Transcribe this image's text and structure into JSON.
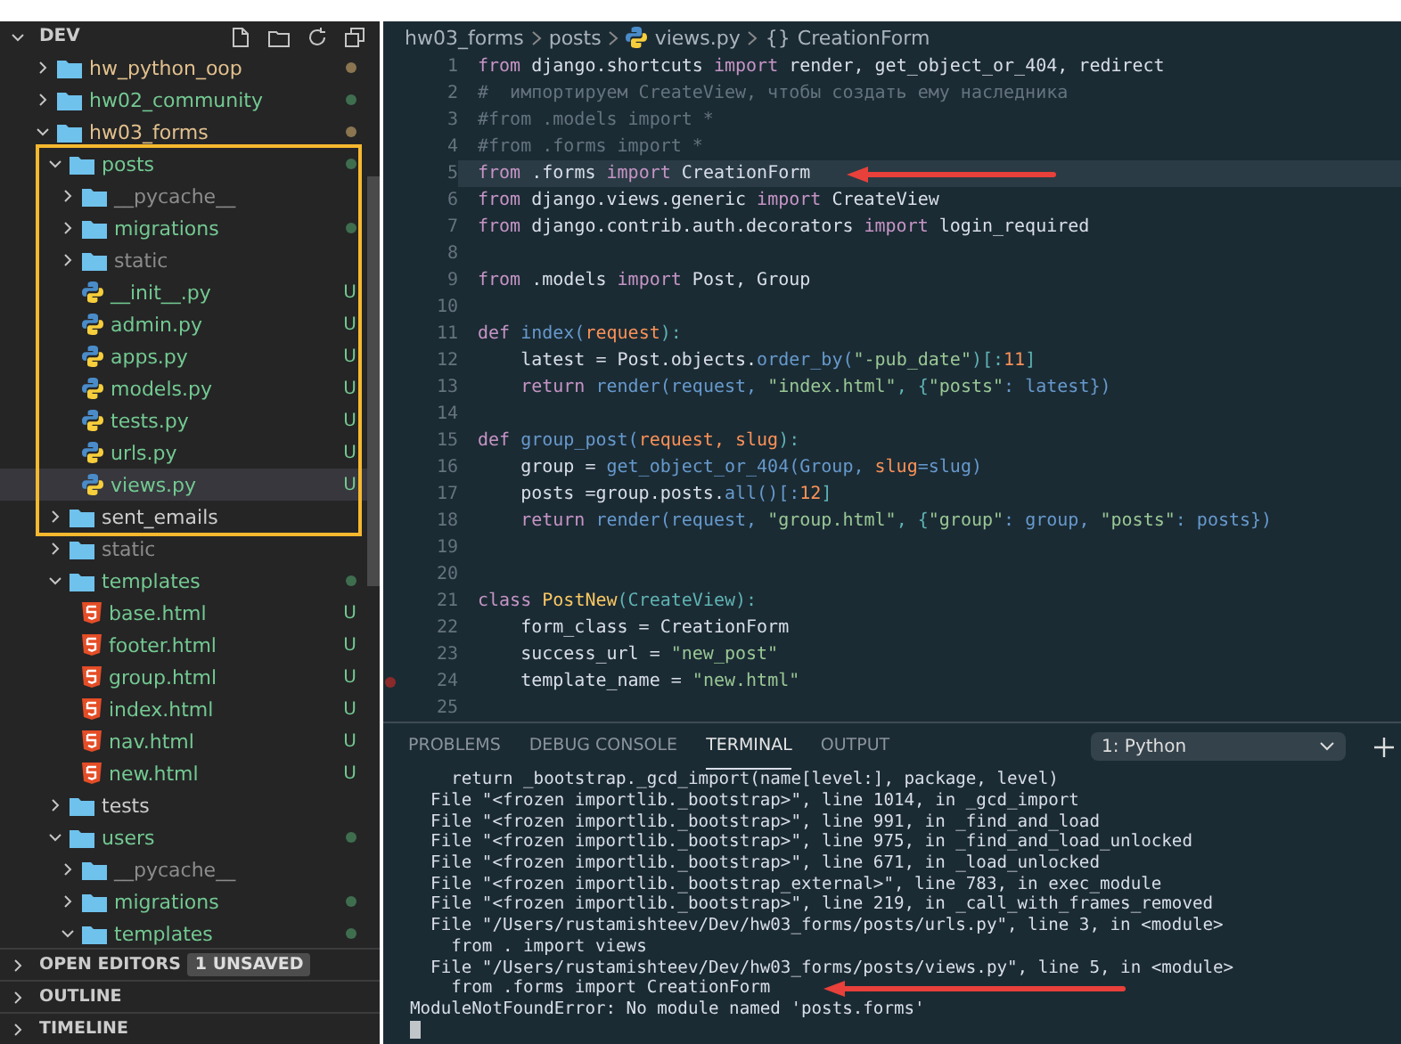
{
  "explorer": {
    "title": "DEV",
    "tree": [
      {
        "name": "hw_python_oop",
        "kind": "folder",
        "expanded": false,
        "color": "#e2c08d",
        "dot": {
          "color": "#8a7550"
        },
        "selected": false
      },
      {
        "name": "hw02_community",
        "kind": "folder",
        "expanded": false,
        "color": "#73c991",
        "dot": {
          "color": "#3f6e4f"
        },
        "selected": false
      },
      {
        "name": "hw03_forms",
        "kind": "folder",
        "expanded": true,
        "color": "#e2c08d",
        "dot": {
          "color": "#8a7550"
        },
        "selected": false,
        "children": [
          {
            "name": "posts",
            "kind": "folder",
            "expanded": true,
            "color": "#73c991",
            "dot": {
              "color": "#3f6e4f"
            },
            "selected": false,
            "children": [
              {
                "name": "__pycache__",
                "kind": "folder",
                "expanded": false,
                "color": "#8c8c8c",
                "selected": false
              },
              {
                "name": "migrations",
                "kind": "folder",
                "expanded": false,
                "color": "#73c991",
                "dot": {
                  "color": "#3f6e4f"
                },
                "selected": false
              },
              {
                "name": "static",
                "kind": "folder",
                "expanded": false,
                "color": "#8c8c8c",
                "selected": false
              },
              {
                "name": "__init__.py",
                "kind": "python",
                "color": "#73c991",
                "badge": "U",
                "selected": false
              },
              {
                "name": "admin.py",
                "kind": "python",
                "color": "#73c991",
                "badge": "U",
                "selected": false
              },
              {
                "name": "apps.py",
                "kind": "python",
                "color": "#73c991",
                "badge": "U",
                "selected": false
              },
              {
                "name": "models.py",
                "kind": "python",
                "color": "#73c991",
                "badge": "U",
                "selected": false
              },
              {
                "name": "tests.py",
                "kind": "python",
                "color": "#73c991",
                "badge": "U",
                "selected": false
              },
              {
                "name": "urls.py",
                "kind": "python",
                "color": "#73c991",
                "badge": "U",
                "selected": false
              },
              {
                "name": "views.py",
                "kind": "python",
                "color": "#73c991",
                "badge": "U",
                "selected": true
              }
            ]
          },
          {
            "name": "sent_emails",
            "kind": "folder",
            "expanded": false,
            "color": "#cccccc",
            "selected": false
          },
          {
            "name": "static",
            "kind": "folder",
            "expanded": false,
            "color": "#8c8c8c",
            "selected": false
          },
          {
            "name": "templates",
            "kind": "folder",
            "expanded": true,
            "color": "#73c991",
            "dot": {
              "color": "#3f6e4f"
            },
            "selected": false,
            "children": [
              {
                "name": "base.html",
                "kind": "html",
                "color": "#73c991",
                "badge": "U",
                "selected": false
              },
              {
                "name": "footer.html",
                "kind": "html",
                "color": "#73c991",
                "badge": "U",
                "selected": false
              },
              {
                "name": "group.html",
                "kind": "html",
                "color": "#73c991",
                "badge": "U",
                "selected": false
              },
              {
                "name": "index.html",
                "kind": "html",
                "color": "#73c991",
                "badge": "U",
                "selected": false
              },
              {
                "name": "nav.html",
                "kind": "html",
                "color": "#73c991",
                "badge": "U",
                "selected": false
              },
              {
                "name": "new.html",
                "kind": "html",
                "color": "#73c991",
                "badge": "U",
                "selected": false
              }
            ]
          },
          {
            "name": "tests",
            "kind": "folder",
            "expanded": false,
            "color": "#cccccc",
            "selected": false
          },
          {
            "name": "users",
            "kind": "folder",
            "expanded": true,
            "color": "#73c991",
            "dot": {
              "color": "#3f6e4f"
            },
            "selected": false,
            "children": [
              {
                "name": "__pycache__",
                "kind": "folder",
                "expanded": false,
                "color": "#8c8c8c",
                "selected": false
              },
              {
                "name": "migrations",
                "kind": "folder",
                "expanded": false,
                "color": "#73c991",
                "dot": {
                  "color": "#3f6e4f"
                },
                "selected": false
              },
              {
                "name": "templates",
                "kind": "folder",
                "expanded": true,
                "color": "#73c991",
                "dot": {
                  "color": "#3f6e4f"
                },
                "selected": false
              }
            ]
          }
        ]
      }
    ],
    "sections": [
      {
        "label": "OPEN EDITORS",
        "badge": "1 UNSAVED"
      },
      {
        "label": "OUTLINE"
      },
      {
        "label": "TIMELINE"
      }
    ]
  },
  "breadcrumb": [
    {
      "kind": "folder",
      "text": "hw03_forms"
    },
    {
      "kind": "folder",
      "text": "posts"
    },
    {
      "kind": "python",
      "text": "views.py"
    },
    {
      "kind": "symbol",
      "icon": "{}",
      "text": "CreationForm"
    }
  ],
  "editor": {
    "lines": [
      {
        "number": "1",
        "tokens": [
          {
            "kind": "kw",
            "text": "from"
          },
          {
            "kind": "id",
            "text": " django.shortcuts "
          },
          {
            "kind": "kw",
            "text": "import"
          },
          {
            "kind": "id",
            "text": " render, get_object_or_404, redirect"
          }
        ],
        "current": false,
        "breakpoint": false,
        "arrow": false
      },
      {
        "number": "2",
        "tokens": [
          {
            "kind": "cm",
            "text": "#  импортируем CreateView, чтобы создать ему наследника"
          }
        ],
        "current": false,
        "breakpoint": false,
        "arrow": false
      },
      {
        "number": "3",
        "tokens": [
          {
            "kind": "cm",
            "text": "#from .models import *"
          }
        ],
        "current": false,
        "breakpoint": false,
        "arrow": false
      },
      {
        "number": "4",
        "tokens": [
          {
            "kind": "cm",
            "text": "#from .forms import *"
          }
        ],
        "current": false,
        "breakpoint": false,
        "arrow": false
      },
      {
        "number": "5",
        "tokens": [
          {
            "kind": "kw",
            "text": "from"
          },
          {
            "kind": "id",
            "text": " .forms "
          },
          {
            "kind": "kw",
            "text": "import"
          },
          {
            "kind": "id",
            "text": " CreationForm"
          }
        ],
        "current": true,
        "breakpoint": false,
        "arrow": true
      },
      {
        "number": "6",
        "tokens": [
          {
            "kind": "kw",
            "text": "from"
          },
          {
            "kind": "id",
            "text": " django.views.generic "
          },
          {
            "kind": "kw",
            "text": "import"
          },
          {
            "kind": "id",
            "text": " CreateView"
          }
        ],
        "current": false,
        "breakpoint": false,
        "arrow": false
      },
      {
        "number": "7",
        "tokens": [
          {
            "kind": "kw",
            "text": "from"
          },
          {
            "kind": "id",
            "text": " django.contrib.auth.decorators "
          },
          {
            "kind": "kw",
            "text": "import"
          },
          {
            "kind": "id",
            "text": " login_required"
          }
        ],
        "current": false,
        "breakpoint": false,
        "arrow": false
      },
      {
        "number": "8",
        "current": false,
        "breakpoint": false,
        "arrow": false
      },
      {
        "number": "9",
        "tokens": [
          {
            "kind": "kw",
            "text": "from"
          },
          {
            "kind": "id",
            "text": " .models "
          },
          {
            "kind": "kw",
            "text": "import"
          },
          {
            "kind": "id",
            "text": " Post, Group"
          }
        ],
        "current": false,
        "breakpoint": false,
        "arrow": false
      },
      {
        "number": "10",
        "current": false,
        "breakpoint": false,
        "arrow": false
      },
      {
        "number": "11",
        "tokens": [
          {
            "kind": "kw",
            "text": "def"
          },
          {
            "kind": "fn",
            "text": " index("
          },
          {
            "kind": "param",
            "text": "request"
          },
          {
            "kind": "op",
            "text": "):"
          }
        ],
        "current": false,
        "breakpoint": false,
        "arrow": false
      },
      {
        "number": "12",
        "tokens": [
          {
            "kind": "id",
            "text": "    latest = Post.objects."
          },
          {
            "kind": "fn",
            "text": "order_by("
          },
          {
            "kind": "str",
            "text": "\"-pub_date\""
          },
          {
            "kind": "op",
            "text": ")[:"
          },
          {
            "kind": "num",
            "text": "11"
          },
          {
            "kind": "op",
            "text": "]"
          }
        ],
        "current": false,
        "breakpoint": false,
        "arrow": false
      },
      {
        "number": "13",
        "tokens": [
          {
            "kind": "kw",
            "text": "    return"
          },
          {
            "kind": "fn",
            "text": " render(request, "
          },
          {
            "kind": "str",
            "text": "\"index.html\""
          },
          {
            "kind": "op",
            "text": ", {"
          },
          {
            "kind": "str",
            "text": "\"posts\""
          },
          {
            "kind": "fn",
            "text": ": latest})"
          }
        ],
        "current": false,
        "breakpoint": false,
        "arrow": false
      },
      {
        "number": "14",
        "current": false,
        "breakpoint": false,
        "arrow": false
      },
      {
        "number": "15",
        "tokens": [
          {
            "kind": "kw",
            "text": "def"
          },
          {
            "kind": "fn",
            "text": " group_post("
          },
          {
            "kind": "param",
            "text": "request, slug"
          },
          {
            "kind": "op",
            "text": "):"
          }
        ],
        "current": false,
        "breakpoint": false,
        "arrow": false
      },
      {
        "number": "16",
        "tokens": [
          {
            "kind": "id",
            "text": "    group = "
          },
          {
            "kind": "fn",
            "text": "get_object_or_404(Group, "
          },
          {
            "kind": "param",
            "text": "slug"
          },
          {
            "kind": "fn",
            "text": "=slug)"
          }
        ],
        "current": false,
        "breakpoint": false,
        "arrow": false
      },
      {
        "number": "17",
        "tokens": [
          {
            "kind": "id",
            "text": "    posts =group.posts."
          },
          {
            "kind": "fn",
            "text": "all()[:"
          },
          {
            "kind": "num",
            "text": "12"
          },
          {
            "kind": "op",
            "text": "]"
          }
        ],
        "current": false,
        "breakpoint": false,
        "arrow": false
      },
      {
        "number": "18",
        "tokens": [
          {
            "kind": "kw",
            "text": "    return"
          },
          {
            "kind": "fn",
            "text": " render(request, "
          },
          {
            "kind": "str",
            "text": "\"group.html\""
          },
          {
            "kind": "op",
            "text": ", {"
          },
          {
            "kind": "str",
            "text": "\"group\""
          },
          {
            "kind": "fn",
            "text": ": group, "
          },
          {
            "kind": "str",
            "text": "\"posts\""
          },
          {
            "kind": "fn",
            "text": ": posts})"
          }
        ],
        "current": false,
        "breakpoint": false,
        "arrow": false
      },
      {
        "number": "19",
        "current": false,
        "breakpoint": false,
        "arrow": false
      },
      {
        "number": "20",
        "current": false,
        "breakpoint": false,
        "arrow": false
      },
      {
        "number": "21",
        "tokens": [
          {
            "kind": "kw",
            "text": "class"
          },
          {
            "kind": "cls",
            "text": " PostNew"
          },
          {
            "kind": "op",
            "text": "(CreateView):"
          }
        ],
        "current": false,
        "breakpoint": false,
        "arrow": false
      },
      {
        "number": "22",
        "tokens": [
          {
            "kind": "id",
            "text": "    form_class = CreationForm"
          }
        ],
        "current": false,
        "breakpoint": false,
        "arrow": false
      },
      {
        "number": "23",
        "tokens": [
          {
            "kind": "id",
            "text": "    success_url = "
          },
          {
            "kind": "str",
            "text": "\"new_post\""
          }
        ],
        "current": false,
        "breakpoint": false,
        "arrow": false
      },
      {
        "number": "24",
        "tokens": [
          {
            "kind": "id",
            "text": "    template_name = "
          },
          {
            "kind": "str",
            "text": "\"new.html\""
          }
        ],
        "current": false,
        "breakpoint": true,
        "arrow": false
      },
      {
        "number": "25",
        "current": false,
        "breakpoint": false,
        "arrow": false
      }
    ]
  },
  "panel": {
    "tabs": [
      {
        "label": "PROBLEMS",
        "selected": false
      },
      {
        "label": "DEBUG CONSOLE",
        "selected": false
      },
      {
        "label": "TERMINAL",
        "selected": true
      },
      {
        "label": "OUTPUT",
        "selected": false
      }
    ],
    "terminal_select": "1: Python",
    "terminal": {
      "lines": [
        {
          "text": "    return _bootstrap._gcd_import(name[level:], package, level)",
          "arrow": false
        },
        {
          "text": "  File \"<frozen importlib._bootstrap>\", line 1014, in _gcd_import",
          "arrow": false
        },
        {
          "text": "  File \"<frozen importlib._bootstrap>\", line 991, in _find_and_load",
          "arrow": false
        },
        {
          "text": "  File \"<frozen importlib._bootstrap>\", line 975, in _find_and_load_unlocked",
          "arrow": false
        },
        {
          "text": "  File \"<frozen importlib._bootstrap>\", line 671, in _load_unlocked",
          "arrow": false
        },
        {
          "text": "  File \"<frozen importlib._bootstrap_external>\", line 783, in exec_module",
          "arrow": false
        },
        {
          "text": "  File \"<frozen importlib._bootstrap>\", line 219, in _call_with_frames_removed",
          "arrow": false
        },
        {
          "text": "  File \"/Users/rustamishteev/Dev/hw03_forms/posts/urls.py\", line 3, in <module>",
          "arrow": false
        },
        {
          "text": "    from . import views",
          "arrow": false
        },
        {
          "text": "  File \"/Users/rustamishteev/Dev/hw03_forms/posts/views.py\", line 5, in <module>",
          "arrow": false
        },
        {
          "text": "    from .forms import CreationForm",
          "arrow": true
        },
        {
          "text": "ModuleNotFoundError: No module named 'posts.forms'",
          "arrow": false
        }
      ],
      "cursor": true
    }
  }
}
